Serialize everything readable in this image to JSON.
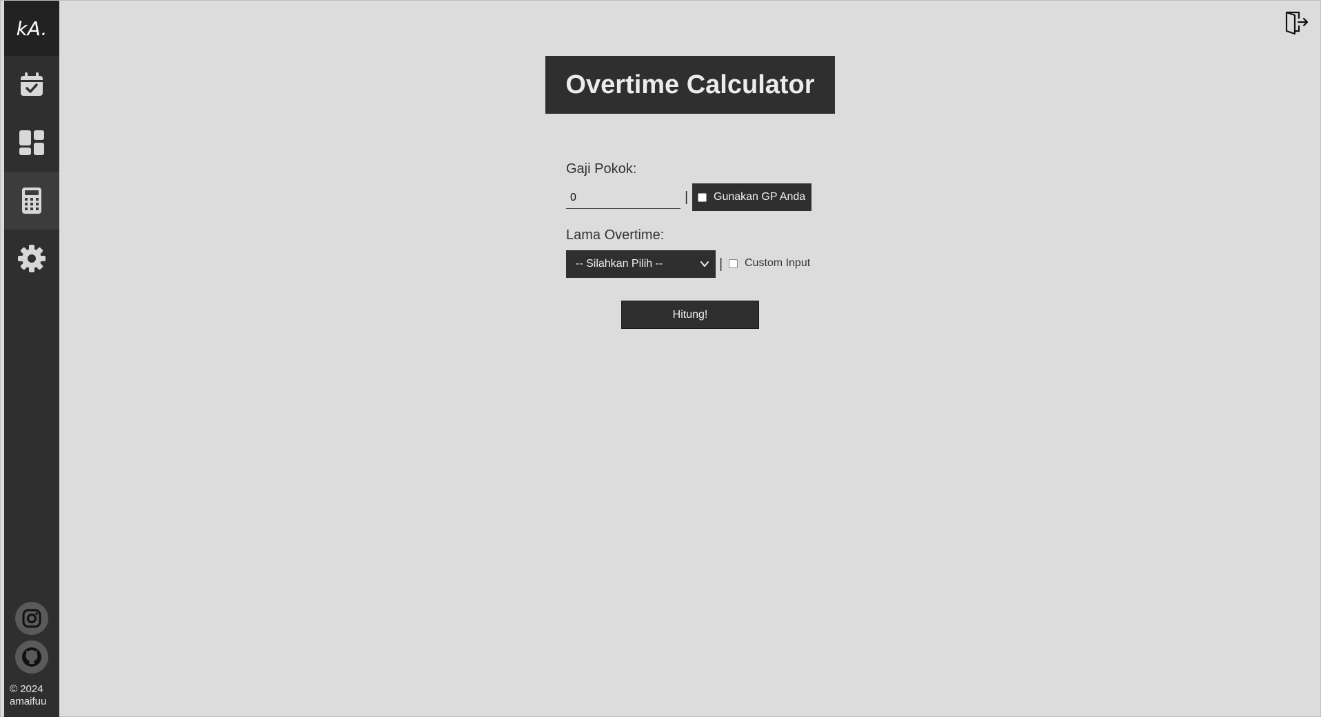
{
  "sidebar": {
    "brand": "kA.",
    "items": [
      {
        "name": "calendar",
        "icon": "calendar-check-icon",
        "active": false
      },
      {
        "name": "dashboard",
        "icon": "dashboard-icon",
        "active": false
      },
      {
        "name": "calculator",
        "icon": "calculator-icon",
        "active": true
      },
      {
        "name": "settings",
        "icon": "gear-icon",
        "active": false
      }
    ],
    "social": [
      {
        "name": "instagram",
        "icon": "instagram-icon"
      },
      {
        "name": "github",
        "icon": "github-icon"
      }
    ],
    "copyright_line1": "© 2024",
    "copyright_line2": "amaifuu"
  },
  "header": {
    "logout_icon": "logout-door-icon"
  },
  "main": {
    "title": "Overtime Calculator",
    "gaji_label": "Gaji Pokok:",
    "gaji_value": "0",
    "separator": "|",
    "gunakan_label": "Gunakan GP Anda",
    "lama_label": "Lama Overtime:",
    "lama_selected": "-- Silahkan Pilih --",
    "custom_input_label": "Custom Input",
    "hitung_label": "Hitung!"
  },
  "colors": {
    "background": "#dcdcdc",
    "sidebar": "#2f2f2f",
    "sidebar_brand": "#222222",
    "accent_dark": "#2f2f2f",
    "icon": "#d8d8d8"
  }
}
